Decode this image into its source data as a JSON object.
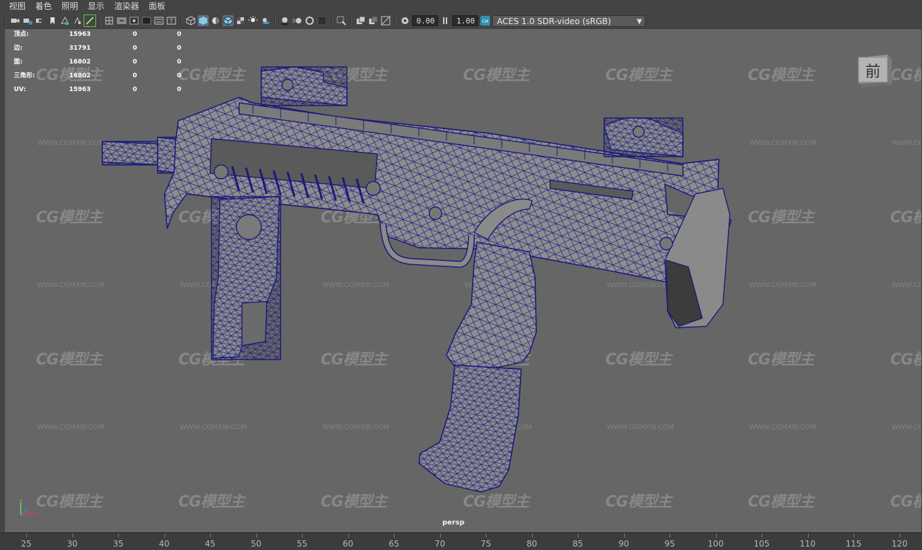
{
  "menu": [
    "视图",
    "着色",
    "照明",
    "显示",
    "渲染器",
    "面板"
  ],
  "toolbar": {
    "exposure": "0.00",
    "gamma": "1.00",
    "colorspace": "ACES 1.0 SDR-video (sRGB)",
    "icons": [
      "camera-icon",
      "camera-attributes-icon",
      "bookmark-icon",
      "image-plane-icon",
      "grid-icon",
      "film-gate-icon",
      "resolution-gate-icon",
      "field-chart-icon",
      "safe-action-icon",
      "wireframe-icon",
      "smooth-shade-icon",
      "wireframe-on-shaded-icon",
      "textured-icon",
      "use-all-lights-icon",
      "shadows-icon",
      "screen-space-ao-icon",
      "motion-blur-icon",
      "anti-aliasing-icon",
      "depth-of-field-icon",
      "isolate-select-icon",
      "xray-icon",
      "xray-joints-icon",
      "backface-culling-icon",
      "exposure-icon",
      "gamma-icon",
      "color-management-icon"
    ]
  },
  "hud": {
    "rows": [
      {
        "label": "顶点:",
        "v1": "15963",
        "v2": "0",
        "v3": "0"
      },
      {
        "label": "边:",
        "v1": "31791",
        "v2": "0",
        "v3": "0"
      },
      {
        "label": "面:",
        "v1": "16802",
        "v2": "0",
        "v3": "0"
      },
      {
        "label": "三角形:",
        "v1": "16802",
        "v2": "0",
        "v3": "0"
      },
      {
        "label": "UV:",
        "v1": "15963",
        "v2": "0",
        "v3": "0"
      }
    ]
  },
  "viewcube": {
    "label": "前"
  },
  "camera": "persp",
  "watermark": {
    "logo": "CG模型主",
    "url": "WWW.CGMXW.COM"
  },
  "timeline": {
    "ticks": [
      "25",
      "30",
      "35",
      "40",
      "45",
      "50",
      "55",
      "60",
      "65",
      "70",
      "75",
      "80",
      "85",
      "90",
      "95",
      "100",
      "105",
      "110",
      "115",
      "120"
    ]
  },
  "colors": {
    "viewport_bg": "#666666",
    "wire": "#1a1a7a",
    "ui_bg": "#444444"
  }
}
